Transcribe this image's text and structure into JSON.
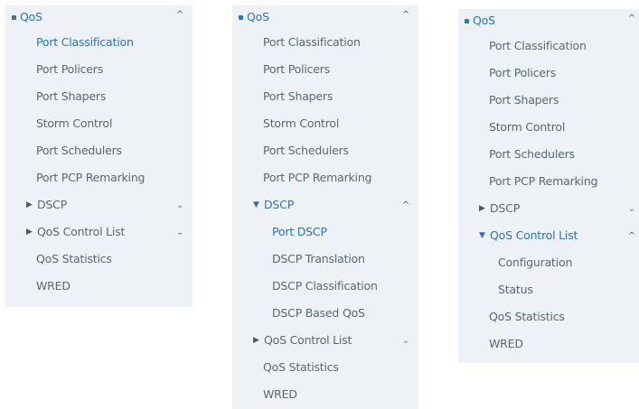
{
  "panels": [
    {
      "header": "QoS",
      "items": [
        "Port Classification",
        "Port Policers",
        "Port Shapers",
        "Storm Control",
        "Port Schedulers",
        "Port PCP Remarking"
      ],
      "groups": [
        "DSCP",
        "QoS Control List"
      ],
      "footer": [
        "QoS Statistics",
        "WRED"
      ]
    },
    {
      "header": "QoS",
      "items": [
        "Port Classification",
        "Port Policers",
        "Port Shapers",
        "Storm Control",
        "Port Schedulers",
        "Port PCP Remarking"
      ],
      "open_group": "DSCP",
      "sub_items": [
        "Port DSCP",
        "DSCP Translation",
        "DSCP Classification",
        "DSCP Based QoS"
      ],
      "groups": [
        "QoS Control List"
      ],
      "footer": [
        "QoS Statistics",
        "WRED"
      ]
    },
    {
      "header": "QoS",
      "items": [
        "Port Classification",
        "Port Policers",
        "Port Shapers",
        "Storm Control",
        "Port Schedulers",
        "Port PCP Remarking"
      ],
      "groups": [
        "DSCP"
      ],
      "open_group": "QoS Control List",
      "sub_items": [
        "Configuration",
        "Status"
      ],
      "footer": [
        "QoS Statistics",
        "WRED"
      ]
    }
  ],
  "colors": {
    "accent": "#2f73b8",
    "text": "#5d6670",
    "panel_bg": "#eef2f6"
  }
}
